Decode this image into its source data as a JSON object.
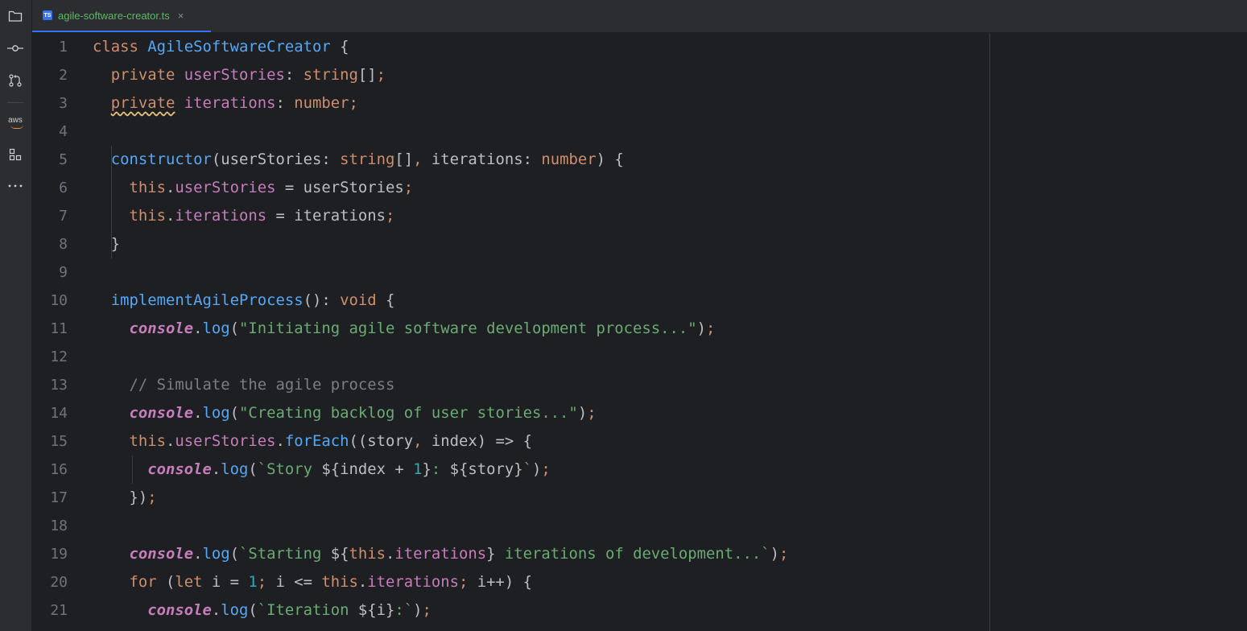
{
  "activity_bar": {
    "items": [
      {
        "name": "project-folder-icon"
      },
      {
        "name": "commit-icon"
      },
      {
        "name": "pull-requests-icon"
      },
      {
        "name": "aws-icon",
        "label": "aws"
      },
      {
        "name": "structure-icon"
      },
      {
        "name": "more-icon"
      }
    ]
  },
  "tab": {
    "badge": "TS",
    "filename": "agile-software-creator.ts",
    "close": "×"
  },
  "editor": {
    "line_numbers": [
      "1",
      "2",
      "3",
      "4",
      "5",
      "6",
      "7",
      "8",
      "9",
      "10",
      "11",
      "12",
      "13",
      "14",
      "15",
      "16",
      "17",
      "18",
      "19",
      "20",
      "21"
    ],
    "lines": {
      "l1": [
        [
          "kw",
          "class "
        ],
        [
          "cls",
          "AgileSoftwareCreator"
        ],
        [
          "punc",
          " {"
        ]
      ],
      "l2": [
        [
          "kw",
          "  private "
        ],
        [
          "fld",
          "userStories"
        ],
        [
          "punc",
          ": "
        ],
        [
          "typ",
          "string"
        ],
        [
          "punc",
          "[]"
        ],
        [
          "semi",
          ";"
        ]
      ],
      "l3": [
        [
          "kw",
          "  private "
        ],
        [
          "fld",
          "iterations"
        ],
        [
          "punc",
          ": "
        ],
        [
          "typ",
          "number"
        ],
        [
          "semi",
          ";"
        ]
      ],
      "l4": [],
      "l5": [
        [
          "fn",
          "  constructor"
        ],
        [
          "punc",
          "(userStories: "
        ],
        [
          "typ",
          "string"
        ],
        [
          "punc",
          "[]"
        ],
        [
          "semi",
          ","
        ],
        [
          "punc",
          " iterations: "
        ],
        [
          "typ",
          "number"
        ],
        [
          "punc",
          ") {"
        ]
      ],
      "l6": [
        [
          "kw",
          "    this"
        ],
        [
          "punc",
          "."
        ],
        [
          "fld",
          "userStories"
        ],
        [
          "punc",
          " = userStories"
        ],
        [
          "semi",
          ";"
        ]
      ],
      "l7": [
        [
          "kw",
          "    this"
        ],
        [
          "punc",
          "."
        ],
        [
          "fld",
          "iterations"
        ],
        [
          "punc",
          " = iterations"
        ],
        [
          "semi",
          ";"
        ]
      ],
      "l8": [
        [
          "punc",
          "  }"
        ]
      ],
      "l9": [],
      "l10": [
        [
          "fnd",
          "  implementAgileProcess"
        ],
        [
          "punc",
          "(): "
        ],
        [
          "kw",
          "void"
        ],
        [
          "punc",
          " {"
        ]
      ],
      "l11": [
        [
          "plain",
          "    "
        ],
        [
          "obj",
          "console"
        ],
        [
          "punc",
          "."
        ],
        [
          "meth",
          "log"
        ],
        [
          "punc",
          "("
        ],
        [
          "str",
          "\"Initiating agile software development process...\""
        ],
        [
          "punc",
          ")"
        ],
        [
          "semi",
          ";"
        ]
      ],
      "l12": [],
      "l13": [
        [
          "cmt",
          "    // Simulate the agile process"
        ]
      ],
      "l14": [
        [
          "plain",
          "    "
        ],
        [
          "obj",
          "console"
        ],
        [
          "punc",
          "."
        ],
        [
          "meth",
          "log"
        ],
        [
          "punc",
          "("
        ],
        [
          "str",
          "\"Creating backlog of user stories...\""
        ],
        [
          "punc",
          ")"
        ],
        [
          "semi",
          ";"
        ]
      ],
      "l15": [
        [
          "kw",
          "    this"
        ],
        [
          "punc",
          "."
        ],
        [
          "fld",
          "userStories"
        ],
        [
          "punc",
          "."
        ],
        [
          "meth",
          "forEach"
        ],
        [
          "punc",
          "((story"
        ],
        [
          "semi",
          ","
        ],
        [
          "punc",
          " index) => {"
        ]
      ],
      "l16": [
        [
          "plain",
          "      "
        ],
        [
          "obj",
          "console"
        ],
        [
          "punc",
          "."
        ],
        [
          "meth",
          "log"
        ],
        [
          "punc",
          "("
        ],
        [
          "str",
          "`Story "
        ],
        [
          "punc",
          "${index + "
        ],
        [
          "num",
          "1"
        ],
        [
          "punc",
          "}"
        ],
        [
          "str",
          ": "
        ],
        [
          "punc",
          "${story}"
        ],
        [
          "str",
          "`"
        ],
        [
          "punc",
          ")"
        ],
        [
          "semi",
          ";"
        ]
      ],
      "l17": [
        [
          "punc",
          "    })"
        ],
        [
          "semi",
          ";"
        ]
      ],
      "l18": [],
      "l19": [
        [
          "plain",
          "    "
        ],
        [
          "obj",
          "console"
        ],
        [
          "punc",
          "."
        ],
        [
          "meth",
          "log"
        ],
        [
          "punc",
          "("
        ],
        [
          "str",
          "`Starting "
        ],
        [
          "punc",
          "${"
        ],
        [
          "kw",
          "this"
        ],
        [
          "punc",
          "."
        ],
        [
          "fld",
          "iterations"
        ],
        [
          "punc",
          "}"
        ],
        [
          "str",
          " iterations of development...`"
        ],
        [
          "punc",
          ")"
        ],
        [
          "semi",
          ";"
        ]
      ],
      "l20": [
        [
          "kw",
          "    for "
        ],
        [
          "punc",
          "("
        ],
        [
          "kw",
          "let "
        ],
        [
          "punc",
          "i = "
        ],
        [
          "num",
          "1"
        ],
        [
          "semi",
          ";"
        ],
        [
          "punc",
          " i <= "
        ],
        [
          "kw",
          "this"
        ],
        [
          "punc",
          "."
        ],
        [
          "fld",
          "iterations"
        ],
        [
          "semi",
          ";"
        ],
        [
          "punc",
          " i++) {"
        ]
      ],
      "l21": [
        [
          "plain",
          "      "
        ],
        [
          "obj",
          "console"
        ],
        [
          "punc",
          "."
        ],
        [
          "meth",
          "log"
        ],
        [
          "punc",
          "("
        ],
        [
          "str",
          "`Iteration "
        ],
        [
          "punc",
          "${i}"
        ],
        [
          "str",
          ":`"
        ],
        [
          "punc",
          ")"
        ],
        [
          "semi",
          ";"
        ]
      ]
    }
  }
}
